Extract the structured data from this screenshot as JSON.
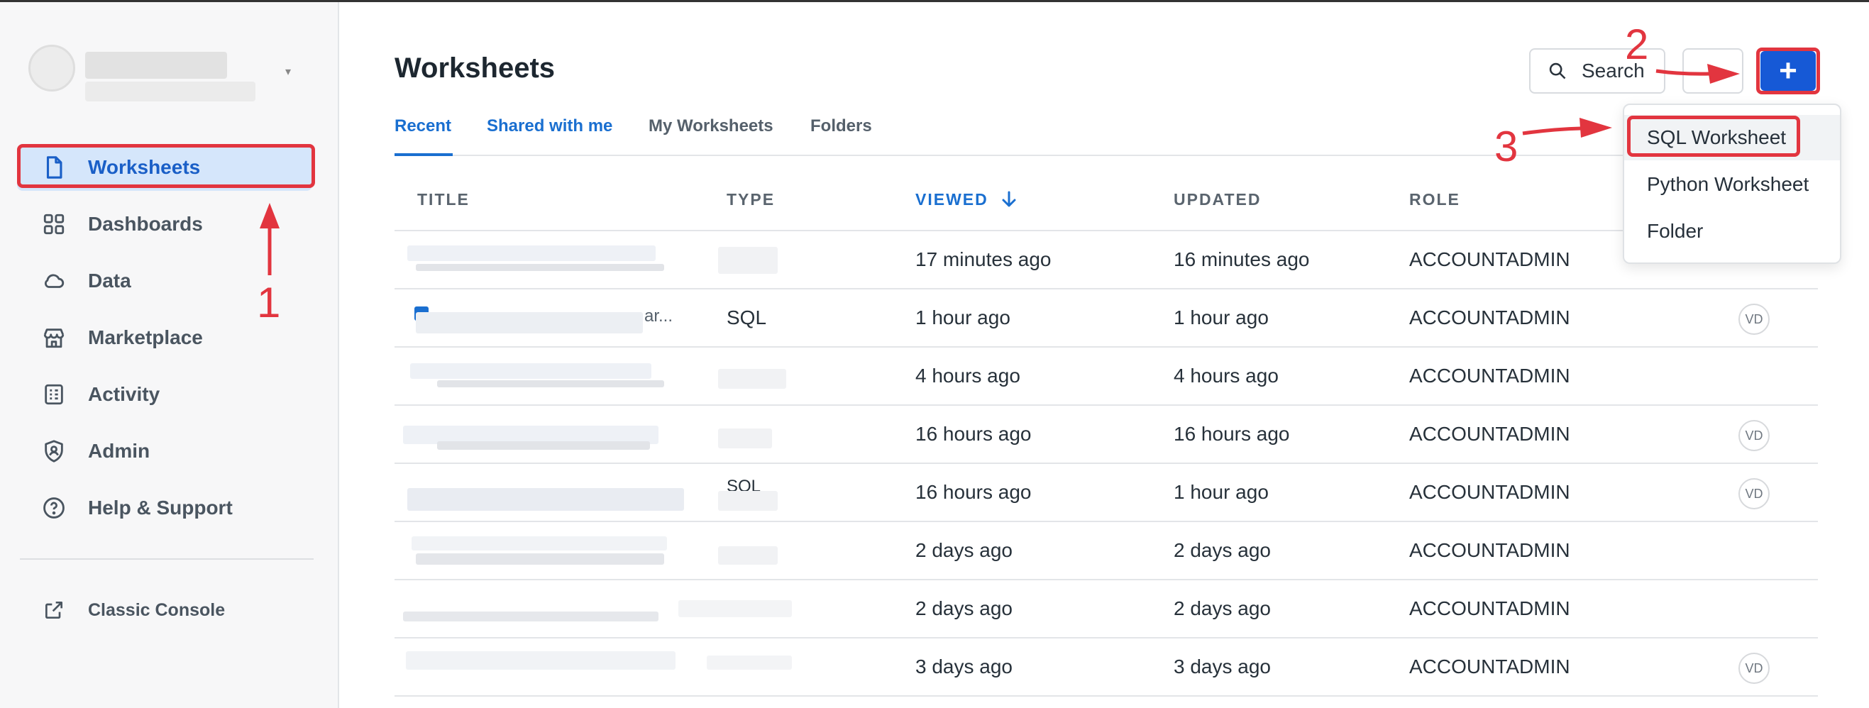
{
  "sidebar": {
    "items": [
      {
        "label": "Worksheets",
        "icon": "document-icon"
      },
      {
        "label": "Dashboards",
        "icon": "grid-icon"
      },
      {
        "label": "Data",
        "icon": "cloud-icon"
      },
      {
        "label": "Marketplace",
        "icon": "storefront-icon"
      },
      {
        "label": "Activity",
        "icon": "activity-log-icon"
      },
      {
        "label": "Admin",
        "icon": "shield-user-icon"
      },
      {
        "label": "Help & Support",
        "icon": "help-circle-icon"
      }
    ],
    "classic_console": {
      "label": "Classic Console",
      "icon": "external-link-icon"
    }
  },
  "main": {
    "title": "Worksheets",
    "tabs": [
      {
        "label": "Recent"
      },
      {
        "label": "Shared with me"
      },
      {
        "label": "My Worksheets"
      },
      {
        "label": "Folders"
      }
    ],
    "search_label": "Search",
    "plus_label": "+"
  },
  "table": {
    "columns": [
      "TITLE",
      "TYPE",
      "VIEWED",
      "UPDATED",
      "ROLE"
    ],
    "rows": [
      {
        "title": "",
        "type": "",
        "viewed": "17 minutes ago",
        "updated": "16 minutes ago",
        "role": "ACCOUNTADMIN",
        "badge": ""
      },
      {
        "title": "ar...",
        "type": "SQL",
        "viewed": "1 hour ago",
        "updated": "1 hour ago",
        "role": "ACCOUNTADMIN",
        "badge": "VD"
      },
      {
        "title": "",
        "type": "",
        "viewed": "4 hours ago",
        "updated": "4 hours ago",
        "role": "ACCOUNTADMIN",
        "badge": ""
      },
      {
        "title": "",
        "type": "",
        "viewed": "16 hours ago",
        "updated": "16 hours ago",
        "role": "ACCOUNTADMIN",
        "badge": "VD"
      },
      {
        "title": "",
        "type": "SQL",
        "viewed": "16 hours ago",
        "updated": "1 hour ago",
        "role": "ACCOUNTADMIN",
        "badge": "VD"
      },
      {
        "title": "",
        "type": "",
        "viewed": "2 days ago",
        "updated": "2 days ago",
        "role": "ACCOUNTADMIN",
        "badge": ""
      },
      {
        "title": "",
        "type": "",
        "viewed": "2 days ago",
        "updated": "2 days ago",
        "role": "ACCOUNTADMIN",
        "badge": ""
      },
      {
        "title": "",
        "type": "",
        "viewed": "3 days ago",
        "updated": "3 days ago",
        "role": "ACCOUNTADMIN",
        "badge": "VD"
      }
    ]
  },
  "dropdown": {
    "items": [
      "SQL Worksheet",
      "Python Worksheet",
      "Folder"
    ]
  },
  "annotations": {
    "labels": [
      "1",
      "2",
      "3"
    ],
    "color": "#e2353f"
  },
  "colors": {
    "accent": "#1a6fd0",
    "primary_button": "#1659d6",
    "active_nav_bg": "#d5e6fb"
  }
}
